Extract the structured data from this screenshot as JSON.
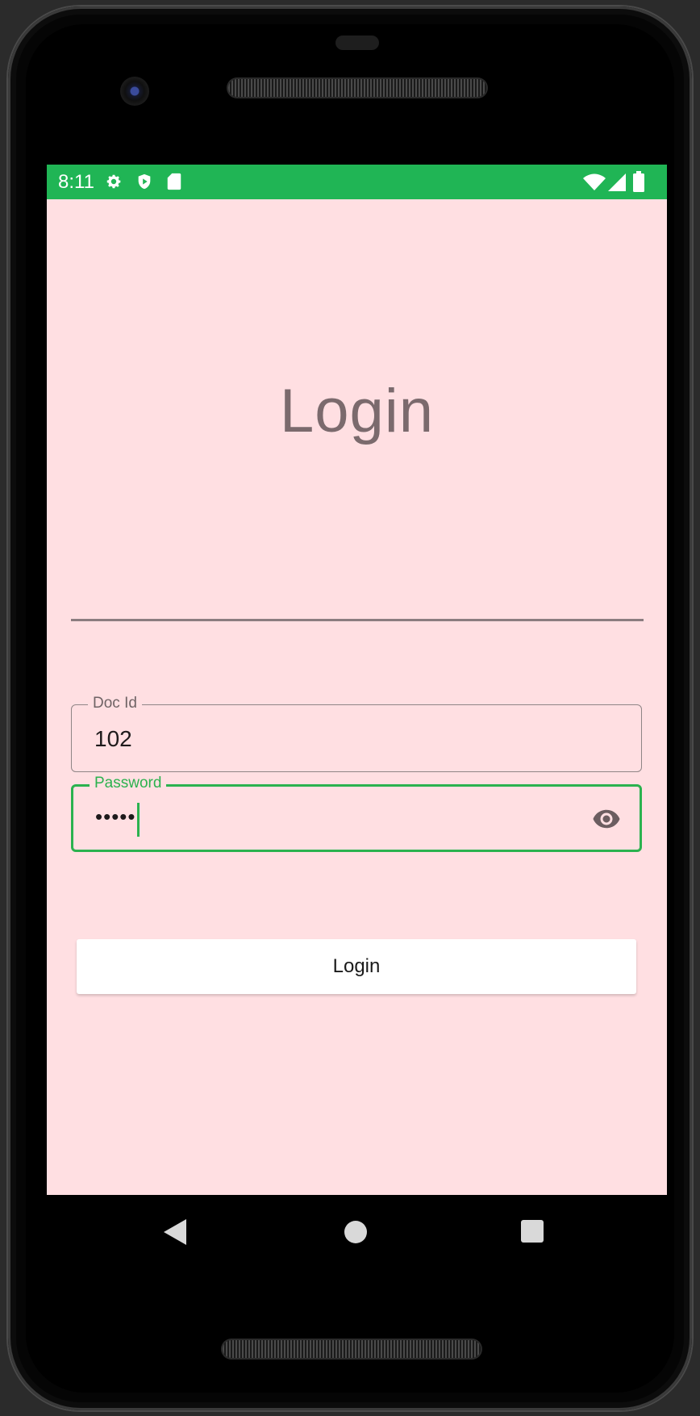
{
  "statusbar": {
    "time": "8:11",
    "left_icons": [
      "gear-icon",
      "shield-icon",
      "sd-card-icon"
    ],
    "right_icons": [
      "wifi-icon",
      "signal-icon",
      "battery-icon"
    ],
    "color": "#20b555"
  },
  "login": {
    "title": "Login",
    "doc_id": {
      "label": "Doc Id",
      "value": "102"
    },
    "password": {
      "label": "Password",
      "masked_value": "•••••",
      "toggle_icon": "eye-icon"
    },
    "button_label": "Login"
  },
  "navbar": {
    "buttons": [
      "back-icon",
      "home-icon",
      "recents-icon"
    ]
  },
  "colors": {
    "background": "#ffdfe2",
    "accent": "#2bb24f",
    "title_text": "#7b6a6d"
  }
}
